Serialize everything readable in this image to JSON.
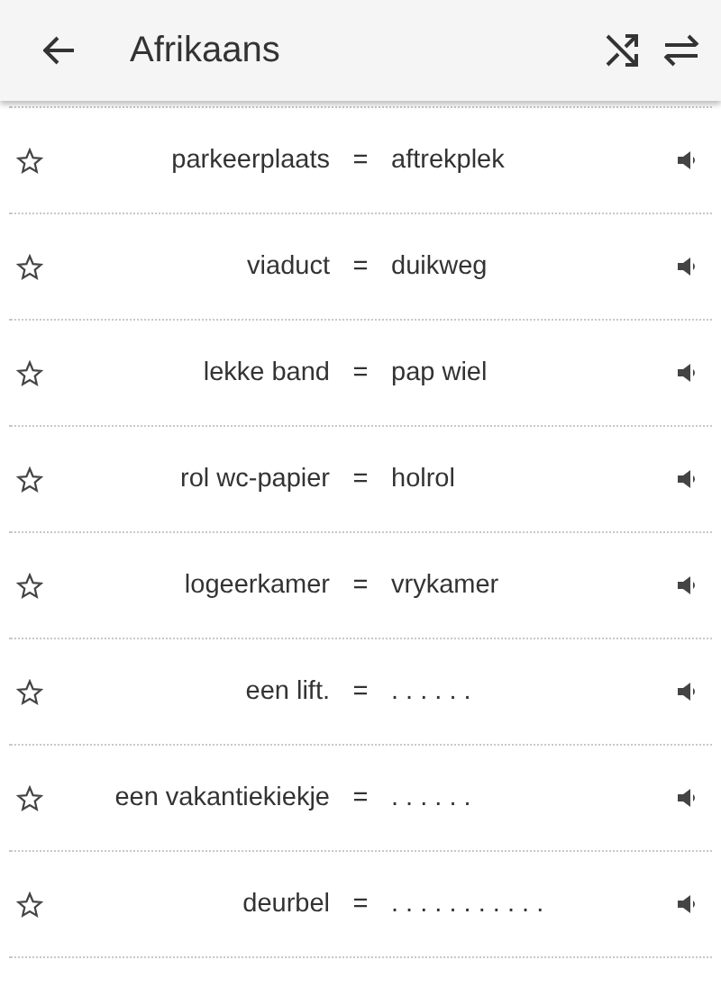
{
  "header": {
    "title": "Afrikaans"
  },
  "rows": [
    {
      "term": "parkeerplaats",
      "sign": "=",
      "translation": "aftrekplek",
      "starred": false
    },
    {
      "term": "viaduct",
      "sign": "=",
      "translation": "duikweg",
      "starred": false
    },
    {
      "term": "lekke band",
      "sign": "=",
      "translation": "pap wiel",
      "starred": false
    },
    {
      "term": "rol wc-papier",
      "sign": "=",
      "translation": "holrol",
      "starred": false
    },
    {
      "term": "logeerkamer",
      "sign": "=",
      "translation": "vrykamer",
      "starred": false
    },
    {
      "term": "een lift.",
      "sign": "=",
      "translation": ". . . . . .",
      "starred": false
    },
    {
      "term": "een vakantiekiekje",
      "sign": "=",
      "translation": ". . . . . .",
      "starred": false
    },
    {
      "term": "deurbel",
      "sign": "=",
      "translation": ". . . . . . . . . . .",
      "starred": false
    }
  ]
}
